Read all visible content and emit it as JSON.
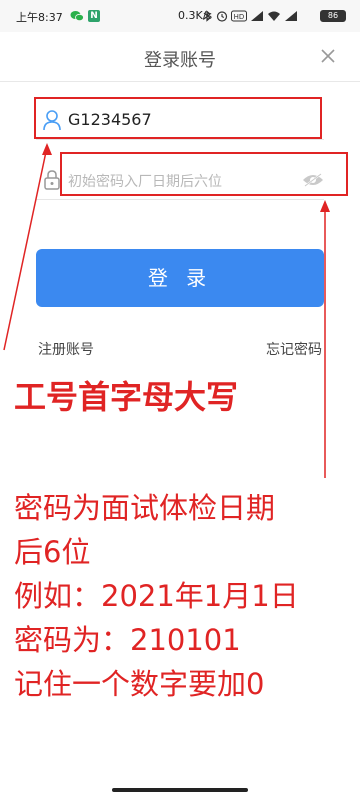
{
  "status_bar": {
    "time": "上午8:37",
    "net_speed": "0.3K/s",
    "battery": "86"
  },
  "header": {
    "title": "登录账号"
  },
  "form": {
    "account_value": "G1234567",
    "password_placeholder": "初始密码入厂日期后六位",
    "login_label": "登 录",
    "register_label": "注册账号",
    "forgot_label": "忘记密码"
  },
  "annotations": {
    "line1": "工号首字母大写",
    "line2": "密码为面试体检日期",
    "line3": "后6位",
    "line4": "例如：2021年1月1日",
    "line5": "密码为：210101",
    "line6": "记住一个数字要加0",
    "color": "#e02424"
  },
  "colors": {
    "primary": "#3b89f0",
    "annotation": "#e02424"
  }
}
